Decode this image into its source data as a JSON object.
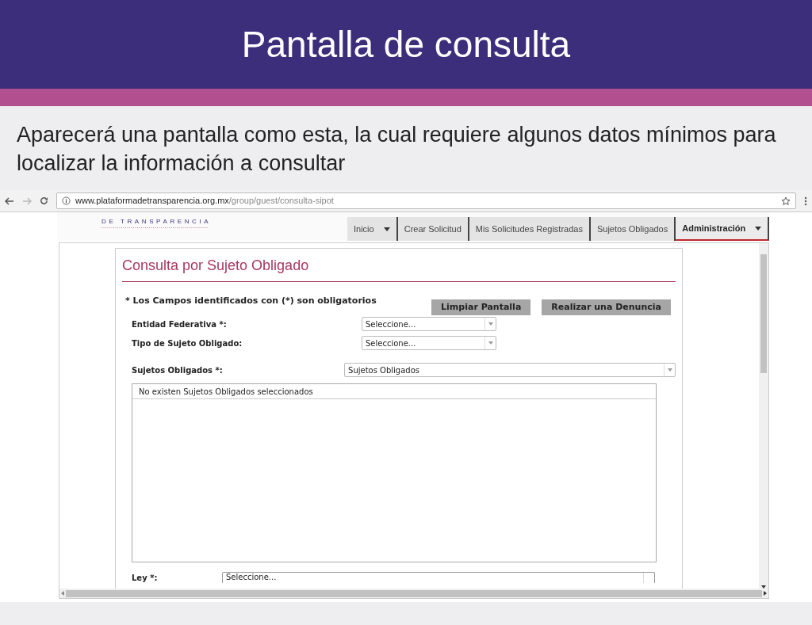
{
  "slide": {
    "title": "Pantalla de consulta",
    "text": "Aparecerá una pantalla como esta, la cual requiere algunos datos mínimos para localizar la información a consultar"
  },
  "browser": {
    "url_host": "www.plataformadetransparencia.org.mx",
    "url_path": "/group/guest/consulta-sipot"
  },
  "site": {
    "logo_text": "DE TRANSPARENCIA"
  },
  "nav": [
    {
      "label": "Inicio",
      "dropdown": true,
      "selected": false
    },
    {
      "label": "Crear Solicitud",
      "dropdown": false,
      "selected": false
    },
    {
      "label": "Mis Solicitudes Registradas",
      "dropdown": false,
      "selected": false
    },
    {
      "label": "Sujetos Obligados",
      "dropdown": false,
      "selected": false
    },
    {
      "label": "Administración",
      "dropdown": true,
      "selected": true
    }
  ],
  "form": {
    "title": "Consulta por Sujeto Obligado",
    "note": "* Los Campos identificados con (*) son obligatorios",
    "buttons": [
      "Limpiar Pantalla",
      "Realizar una Denuncia"
    ],
    "fields": [
      {
        "label": "Entidad Federativa *:",
        "value": "Seleccione...",
        "kind": "short"
      },
      {
        "label": "Tipo de Sujeto Obligado:",
        "value": "Seleccione...",
        "kind": "short"
      },
      {
        "label": "Sujetos Obligados *:",
        "value": "Sujetos Obligados",
        "kind": "wide"
      }
    ],
    "list_header": "No existen Sujetos Obligados seleccionados",
    "last_field": {
      "label": "Ley *:",
      "value": "Seleccione..."
    }
  }
}
